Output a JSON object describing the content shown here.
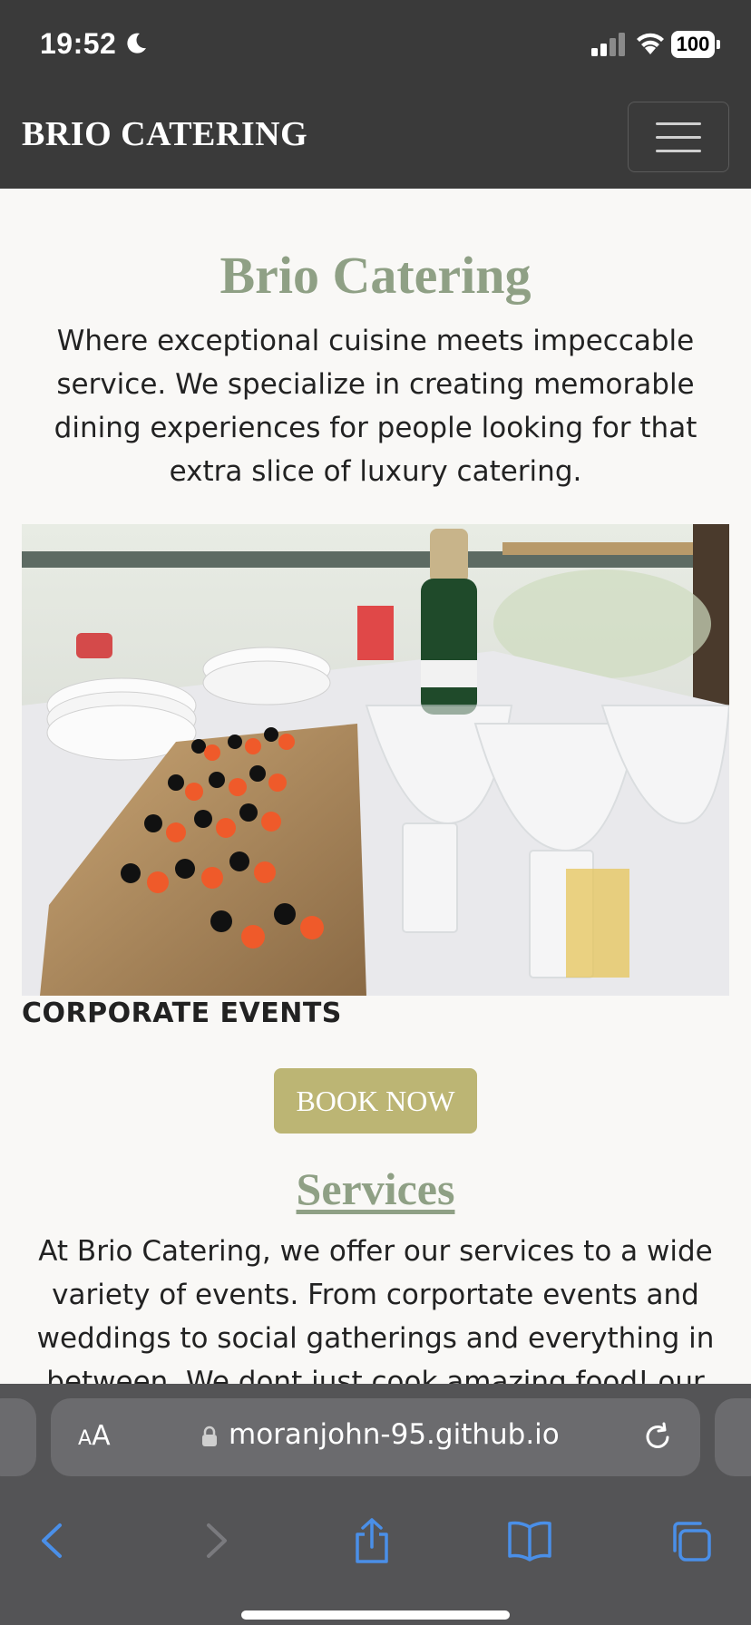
{
  "status_bar": {
    "time": "19:52",
    "battery": "100"
  },
  "navbar": {
    "brand": "BRIO CATERING"
  },
  "hero": {
    "title": "Brio Catering",
    "text": "Where exceptional cuisine meets impeccable service. We specialize in creating memorable dining experiences for people looking for that extra slice of luxury catering."
  },
  "event": {
    "label": "CORPORATE EVENTS",
    "button": "BOOK NOW"
  },
  "services": {
    "title": "Services",
    "text": "At Brio Catering, we offer our services to a wide variety of events. From corportate events and weddings to social gatherings and everything in between. We dont just cook amazing food! our"
  },
  "browser": {
    "text_size": "AA",
    "url": "moranjohn-95.github.io"
  },
  "colors": {
    "nav_bg": "#3a3a3a",
    "accent_green": "#8fa085",
    "button_gold": "#bcb574",
    "page_bg": "#f9f8f6",
    "ios_blue": "#4a8fe8"
  }
}
